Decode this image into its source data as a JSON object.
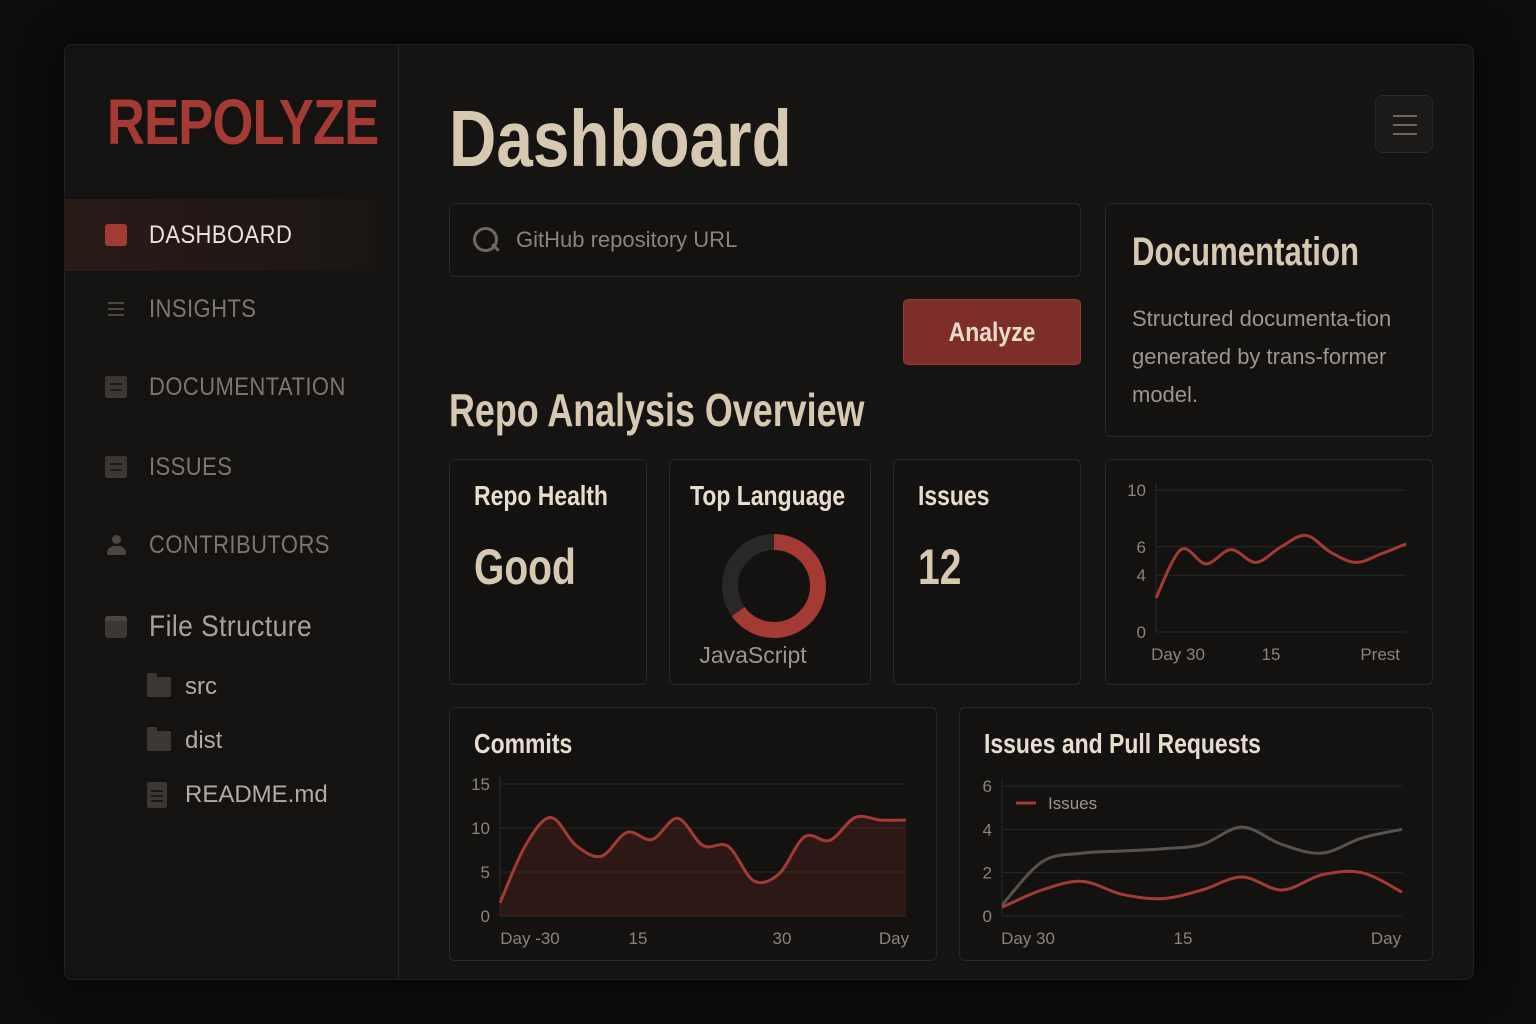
{
  "app": {
    "logo": "REPOLYZE"
  },
  "sidebar": {
    "items": [
      {
        "label": "DASHBOARD",
        "icon": "dashboard-icon",
        "active": true
      },
      {
        "label": "INSIGHTS",
        "icon": "list-icon",
        "active": false
      },
      {
        "label": "DOCUMENTATION",
        "icon": "document-icon",
        "active": false
      },
      {
        "label": "ISSUES",
        "icon": "document-icon",
        "active": false
      },
      {
        "label": "CONTRIBUTORS",
        "icon": "person-icon",
        "active": false
      }
    ],
    "file_structure": {
      "label": "File Structure",
      "items": [
        {
          "name": "src",
          "type": "folder"
        },
        {
          "name": "dist",
          "type": "folder"
        },
        {
          "name": "README.md",
          "type": "file"
        }
      ]
    }
  },
  "header": {
    "title": "Dashboard",
    "menu_icon": "hamburger-menu-icon"
  },
  "search": {
    "placeholder": "GitHub repository URL",
    "value": ""
  },
  "analyze_button": {
    "label": "Analyze"
  },
  "documentation_card": {
    "title": "Documentation",
    "body": "Structured documenta-tion generated by trans-former model."
  },
  "overview": {
    "title": "Repo Analysis Overview",
    "repo_health": {
      "title": "Repo Health",
      "value": "Good"
    },
    "top_language": {
      "title": "Top Language",
      "value": "JavaScript",
      "share": 0.65
    },
    "issues": {
      "title": "Issues",
      "value": "12"
    }
  },
  "colors": {
    "accent": "#a33a33",
    "series_secondary": "#555250",
    "background": "#151413"
  },
  "chart_data": [
    {
      "type": "line",
      "title": "",
      "x_tick_labels": [
        "Day 30",
        "15",
        "Prest"
      ],
      "y_ticks": [
        0,
        4,
        6,
        10
      ],
      "ylim": [
        0,
        10
      ],
      "xlim": [
        0,
        30
      ],
      "series": [
        {
          "x": [
            0,
            3,
            6,
            9,
            12,
            15,
            18,
            21,
            24,
            27,
            30
          ],
          "values": [
            2.4,
            5.8,
            4.8,
            5.8,
            4.9,
            6.0,
            6.8,
            5.6,
            4.9,
            5.5,
            6.2
          ]
        }
      ],
      "grid": true
    },
    {
      "type": "area",
      "title": "Commits",
      "x_tick_labels": [
        "Day -30",
        "15",
        "30",
        "Day"
      ],
      "y_ticks": [
        0,
        5,
        10,
        15
      ],
      "ylim": [
        0,
        15
      ],
      "xlim": [
        0,
        40
      ],
      "series": [
        {
          "x": [
            0,
            2.5,
            5,
            7.5,
            10,
            12.5,
            15,
            17.5,
            20,
            22.5,
            25,
            27.5,
            30,
            32.5,
            35,
            37.5,
            40
          ],
          "values": [
            1.5,
            8.0,
            11.2,
            8.0,
            6.8,
            9.5,
            8.7,
            11.1,
            8.0,
            7.9,
            4.0,
            4.8,
            9.0,
            8.6,
            11.2,
            10.9,
            10.9
          ]
        }
      ],
      "grid": true
    },
    {
      "type": "line",
      "title": "Issues and Pull Requests",
      "x_tick_labels": [
        "Day 30",
        "15",
        "Day"
      ],
      "y_ticks": [
        0,
        2,
        4,
        6
      ],
      "ylim": [
        0,
        6
      ],
      "xlim": [
        0,
        30
      ],
      "legend": "top-left",
      "series": [
        {
          "name": "Issues",
          "x": [
            0,
            3,
            6,
            9,
            12,
            15,
            18,
            21,
            24,
            27,
            30
          ],
          "values": [
            0.4,
            1.2,
            1.6,
            1.0,
            0.8,
            1.2,
            1.8,
            1.2,
            1.9,
            2.0,
            1.1
          ]
        },
        {
          "x": [
            0,
            3,
            6,
            9,
            12,
            15,
            18,
            21,
            24,
            27,
            30
          ],
          "values": [
            0.5,
            2.5,
            2.9,
            3.0,
            3.1,
            3.3,
            4.1,
            3.3,
            2.9,
            3.6,
            4.0
          ]
        }
      ],
      "grid": true
    }
  ]
}
